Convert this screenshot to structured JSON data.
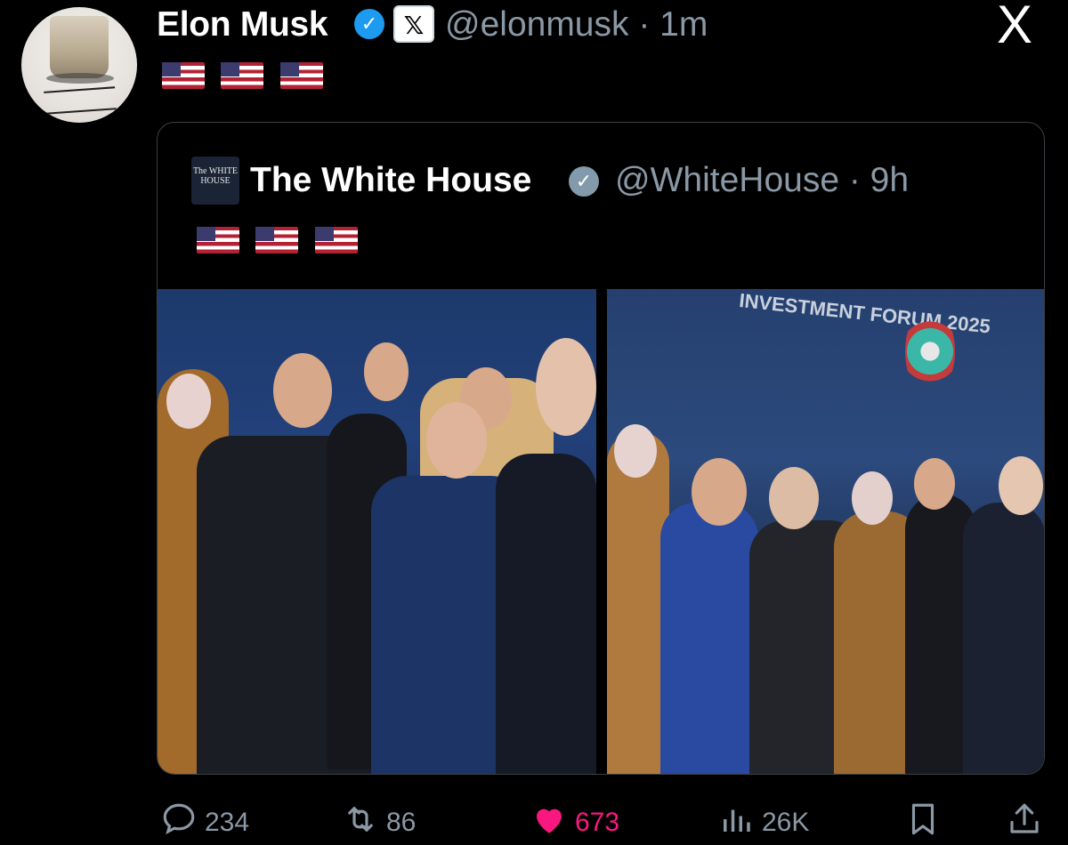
{
  "post": {
    "author_name": "Elon Musk",
    "author_handle": "@elonmusk · 1m",
    "text_flags": [
      "us-flag-emoji",
      "us-flag-emoji",
      "us-flag-emoji"
    ]
  },
  "app": {
    "logo": "X",
    "badge": "𝕏"
  },
  "quoted": {
    "author_name": "The White House",
    "author_handle": "@WhiteHouse · 9h",
    "avatar_text": "The WHITE HOUSE",
    "text_flags": [
      "us-flag-emoji",
      "us-flag-emoji",
      "us-flag-emoji"
    ],
    "photo_right_caption": "INVESTMENT FORUM 2025"
  },
  "actions": {
    "replies": "234",
    "reposts": "86",
    "likes": "673",
    "views": "26K"
  },
  "colors": {
    "background": "#000000",
    "text": "#e7e9ea",
    "muted": "#8b98a5",
    "verified_blue": "#1d9bf0",
    "verified_gray": "#829aab",
    "like_pink": "#f91880"
  }
}
